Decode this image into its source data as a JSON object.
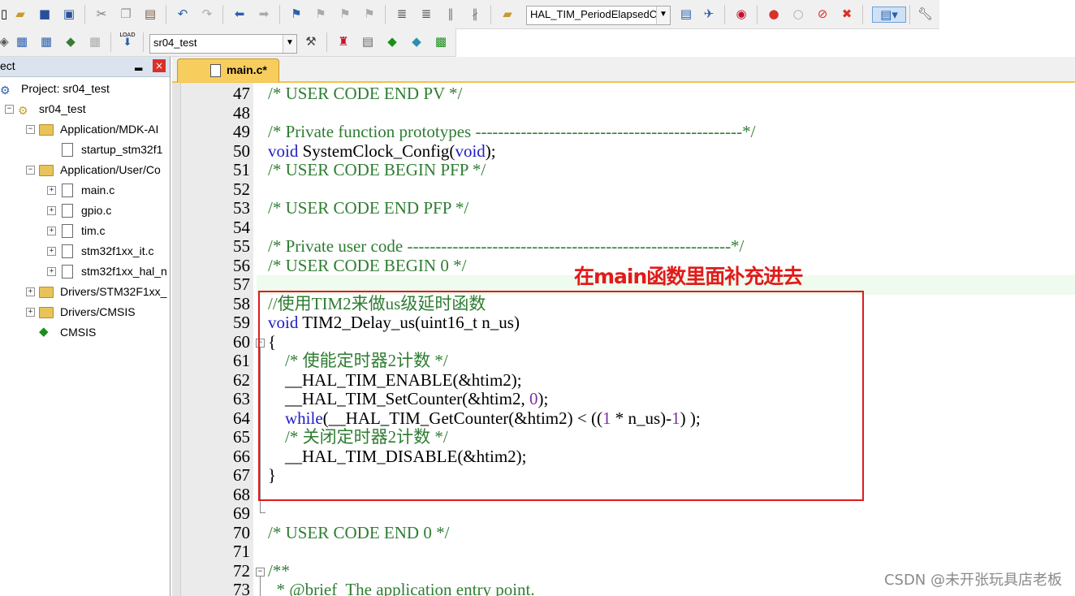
{
  "toolbar1": {
    "function_combo": "HAL_TIM_PeriodElapsedCa"
  },
  "toolbar2": {
    "target_combo": "sr04_test",
    "load_label": "LOAD"
  },
  "project_panel": {
    "title": "ect",
    "close": "×",
    "pin": "▂",
    "tree": [
      {
        "label": "Project: sr04_test",
        "icon": "project-icon",
        "expander": ""
      },
      {
        "label": "sr04_test",
        "icon": "target-icon",
        "expander": "−"
      },
      {
        "label": "Application/MDK-AI",
        "icon": "folder-icon",
        "expander": "−"
      },
      {
        "label": "startup_stm32f1",
        "icon": "file-icon",
        "expander": ""
      },
      {
        "label": "Application/User/Co",
        "icon": "folder-icon",
        "expander": "−"
      },
      {
        "label": "main.c",
        "icon": "file-icon",
        "expander": "+"
      },
      {
        "label": "gpio.c",
        "icon": "file-icon",
        "expander": "+"
      },
      {
        "label": "tim.c",
        "icon": "file-icon",
        "expander": "+"
      },
      {
        "label": "stm32f1xx_it.c",
        "icon": "file-icon",
        "expander": "+"
      },
      {
        "label": "stm32f1xx_hal_n",
        "icon": "file-icon",
        "expander": "+"
      },
      {
        "label": "Drivers/STM32F1xx_",
        "icon": "folder-icon",
        "expander": "+"
      },
      {
        "label": "Drivers/CMSIS",
        "icon": "folder-icon",
        "expander": "+"
      },
      {
        "label": "CMSIS",
        "icon": "cmsis-gem-icon",
        "expander": ""
      }
    ]
  },
  "editor": {
    "tab_label": "main.c*",
    "lines": [
      {
        "n": "47",
        "parts": [
          {
            "t": "/* USER CODE END PV */",
            "c": "com"
          }
        ]
      },
      {
        "n": "48",
        "parts": []
      },
      {
        "n": "49",
        "parts": [
          {
            "t": "/* Private function prototypes -----------------------------------------------*/",
            "c": "com"
          }
        ]
      },
      {
        "n": "50",
        "parts": [
          {
            "t": "void",
            "c": "kw"
          },
          {
            "t": " SystemClock_Config(",
            "c": ""
          },
          {
            "t": "void",
            "c": "kw"
          },
          {
            "t": ");",
            "c": ""
          }
        ]
      },
      {
        "n": "51",
        "parts": [
          {
            "t": "/* USER CODE BEGIN PFP */",
            "c": "com"
          }
        ]
      },
      {
        "n": "52",
        "parts": []
      },
      {
        "n": "53",
        "parts": [
          {
            "t": "/* USER CODE END PFP */",
            "c": "com"
          }
        ]
      },
      {
        "n": "54",
        "parts": []
      },
      {
        "n": "55",
        "parts": [
          {
            "t": "/* Private user code ---------------------------------------------------------*/",
            "c": "com"
          }
        ]
      },
      {
        "n": "56",
        "parts": [
          {
            "t": "/* USER CODE BEGIN 0 */",
            "c": "com"
          }
        ]
      },
      {
        "n": "57",
        "parts": []
      },
      {
        "n": "58",
        "parts": [
          {
            "t": "//使用TIM2来做us级延时函数",
            "c": "com"
          }
        ]
      },
      {
        "n": "59",
        "parts": [
          {
            "t": "void",
            "c": "kw"
          },
          {
            "t": " TIM2_Delay_us(uint16_t n_us)",
            "c": ""
          }
        ]
      },
      {
        "n": "60",
        "parts": [
          {
            "t": "{",
            "c": ""
          }
        ]
      },
      {
        "n": "61",
        "parts": [
          {
            "t": "    /* 使能定时器2计数 */",
            "c": "com"
          }
        ]
      },
      {
        "n": "62",
        "parts": [
          {
            "t": "    __HAL_TIM_ENABLE(&htim2);",
            "c": ""
          }
        ]
      },
      {
        "n": "63",
        "parts": [
          {
            "t": "    __HAL_TIM_SetCounter(&htim2, ",
            "c": ""
          },
          {
            "t": "0",
            "c": "num"
          },
          {
            "t": ");",
            "c": ""
          }
        ]
      },
      {
        "n": "64",
        "parts": [
          {
            "t": "    ",
            "c": ""
          },
          {
            "t": "while",
            "c": "kw"
          },
          {
            "t": "(__HAL_TIM_GetCounter(&htim2) < ((",
            "c": ""
          },
          {
            "t": "1",
            "c": "num"
          },
          {
            "t": " * n_us)-",
            "c": ""
          },
          {
            "t": "1",
            "c": "num"
          },
          {
            "t": ") );",
            "c": ""
          }
        ]
      },
      {
        "n": "65",
        "parts": [
          {
            "t": "    /* 关闭定时器2计数 */",
            "c": "com"
          }
        ]
      },
      {
        "n": "66",
        "parts": [
          {
            "t": "    __HAL_TIM_DISABLE(&htim2);",
            "c": ""
          }
        ]
      },
      {
        "n": "67",
        "parts": [
          {
            "t": "}",
            "c": ""
          }
        ]
      },
      {
        "n": "68",
        "parts": []
      },
      {
        "n": "69",
        "parts": []
      },
      {
        "n": "70",
        "parts": [
          {
            "t": "/* USER CODE END 0 */",
            "c": "com"
          }
        ]
      },
      {
        "n": "71",
        "parts": []
      },
      {
        "n": "72",
        "parts": [
          {
            "t": "/**",
            "c": "com"
          }
        ]
      },
      {
        "n": "73",
        "parts": [
          {
            "t": "  * @brief  The application entry point.",
            "c": "com"
          }
        ]
      }
    ]
  },
  "annotation": "在main函数里面补充进去",
  "watermark": "CSDN @未开张玩具店老板"
}
